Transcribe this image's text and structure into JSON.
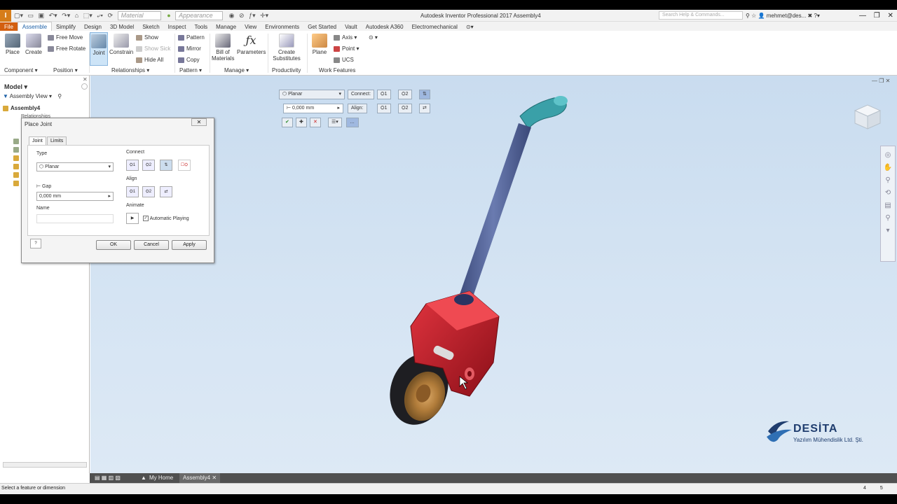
{
  "app": {
    "logo": "I",
    "title": "Autodesk Inventor Professional 2017   Assembly4",
    "search_placeholder": "Search Help & Commands...",
    "user": "mehmet@des...",
    "win_minimize": "—",
    "win_restore": "❐",
    "win_close": "✕"
  },
  "qat": {
    "material": "Material",
    "appearance": "Appearance"
  },
  "tabs": [
    "File",
    "Assemble",
    "Simplify",
    "Design",
    "3D Model",
    "Sketch",
    "Inspect",
    "Tools",
    "Manage",
    "View",
    "Environments",
    "Get Started",
    "Vault",
    "Autodesk A360",
    "Electromechanical"
  ],
  "ribbon": {
    "place": "Place",
    "create": "Create",
    "free_move": "Free Move",
    "free_rotate": "Free Rotate",
    "joint": "Joint",
    "constrain": "Constrain",
    "show": "Show",
    "show_sick": "Show Sick",
    "hide_all": "Hide All",
    "pattern": "Pattern",
    "mirror": "Mirror",
    "copy": "Copy",
    "bom_line1": "Bill of",
    "bom_line2": "Materials",
    "parameters": "Parameters",
    "create_sub_line1": "Create",
    "create_sub_line2": "Substitutes",
    "plane": "Plane",
    "axis": "Axis",
    "point": "Point",
    "ucs": "UCS",
    "groups": {
      "component": "Component",
      "position": "Position",
      "relationships": "Relationships",
      "pattern": "Pattern",
      "manage": "Manage",
      "productivity": "Productivity",
      "work_features": "Work Features"
    }
  },
  "browser": {
    "model_label": "Model",
    "view": "Assembly View",
    "root": "Assembly4",
    "sub": "Relationships"
  },
  "dialog": {
    "title": "Place Joint",
    "tab_joint": "Joint",
    "tab_limits": "Limits",
    "type_label": "Type",
    "type_value": "Planar",
    "gap_label": "Gap",
    "gap_value": "0,000 mm",
    "name_label": "Name",
    "connect_label": "Connect",
    "align_label": "Align",
    "animate_label": "Animate",
    "auto_playing": "Automatic Playing",
    "ok": "OK",
    "cancel": "Cancel",
    "apply": "Apply"
  },
  "minitoolbar": {
    "type": "Planar",
    "connect": "Connect:",
    "align": "Align:",
    "gap": "0,000 mm",
    "one": "1",
    "two": "2"
  },
  "bottom": {
    "my_home": "My Home",
    "doc_tab": "Assembly4",
    "status": "Select a feature or dimension",
    "num1": "4",
    "num2": "5"
  },
  "watermark": {
    "name": "DESİTA",
    "sub": "Yazılım Mühendislik Ltd. Şti."
  },
  "colors": {
    "file_tab": "#d35f0f",
    "accent": "#1d61a8",
    "wheel_bracket": "#c8202c",
    "handle": "#4b5a8c",
    "grip": "#3aa0a8"
  }
}
